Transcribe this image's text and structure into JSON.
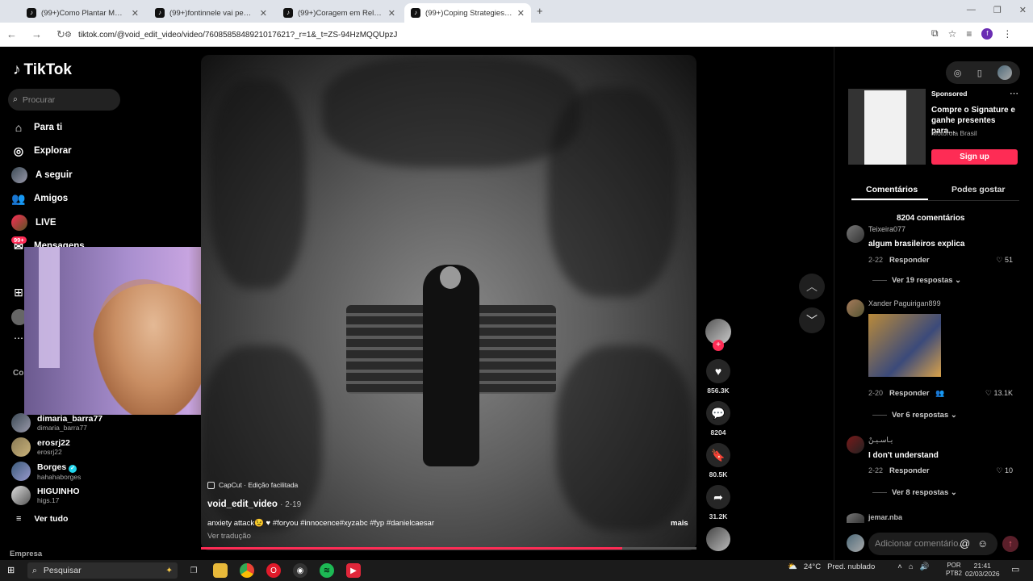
{
  "browser": {
    "tabs": [
      {
        "label": "(99+)Como Plantar Mudas de"
      },
      {
        "label": "(99+)fontinnele vai pegar 20%"
      },
      {
        "label": "(99+)Coragem em Relacionam"
      },
      {
        "label": "(99+)Coping Strategies for An"
      }
    ],
    "new_tab": "+",
    "url": "tiktok.com/@void_edit_video/video/7608585848921017621?_r=1&_t=ZS-94HzMQQUpzJ",
    "profile_initial": "f"
  },
  "tiktok": {
    "logo": "TikTok",
    "search_placeholder": "Procurar",
    "nav": [
      {
        "label": "Para ti",
        "icon": "home-icon"
      },
      {
        "label": "Explorar",
        "icon": "compass-icon"
      },
      {
        "label": "A seguir",
        "icon": "following-icon"
      },
      {
        "label": "Amigos",
        "icon": "friends-icon"
      },
      {
        "label": "LIVE",
        "icon": "live-icon"
      },
      {
        "label": "Mensagens",
        "icon": "messages-icon",
        "badge": "99+"
      }
    ],
    "following_heading": "Co",
    "following": [
      {
        "name": "dimaria_barra77",
        "user": "dimaria_barra77"
      },
      {
        "name": "erosrj22",
        "user": "erosrj22"
      },
      {
        "name": "Borges",
        "user": "hahahaborges",
        "verified": true
      },
      {
        "name": "HIGUINHO",
        "user": "higs.17"
      }
    ],
    "see_all": "Ver tudo",
    "company": "Empresa"
  },
  "video": {
    "capcut": "CapCut · Edição facilitada",
    "author": "void_edit_video",
    "date": "· 2-19",
    "caption": "anxiety attack😉 ♥ #foryou #innocence#xyzabc #fyp #danielcaesar",
    "more": "mais",
    "translate": "Ver tradução",
    "progress": 0.85
  },
  "actions": {
    "likes": "856.3K",
    "comments": "8204",
    "saves": "80.5K",
    "shares": "31.2K"
  },
  "ad": {
    "sponsored": "Sponsored",
    "title": "Compre o Signature e ganhe presentes para...",
    "brand": "Motorola Brasil",
    "cta": "Sign up"
  },
  "panel_tabs": {
    "comments": "Comentários",
    "might_like": "Podes gostar"
  },
  "comments": {
    "count": "8204 comentários",
    "reply_label": "Responder",
    "items": [
      {
        "user": "Teixeira077",
        "text": "algum brasileiros explica",
        "date": "2-22",
        "likes": "51",
        "replies": "Ver 19 respostas"
      },
      {
        "user": "Xander Paguirigan899",
        "text": "",
        "date": "2-20",
        "likes": "13.1K",
        "replies": "Ver 6 respostas"
      },
      {
        "user": "يـاسـيـنْ",
        "text": "I don't understand",
        "date": "2-22",
        "likes": "10",
        "replies": "Ver 8 respostas"
      },
      {
        "user": "jemar.nba",
        "text": ""
      }
    ],
    "add_placeholder": "Adicionar comentário..."
  },
  "taskbar": {
    "search": "Pesquisar",
    "weather_temp": "24°C",
    "weather_desc": "Pred. nublado",
    "lang1": "POR",
    "lang2": "PTB2",
    "time": "21:41",
    "date": "02/03/2026"
  }
}
